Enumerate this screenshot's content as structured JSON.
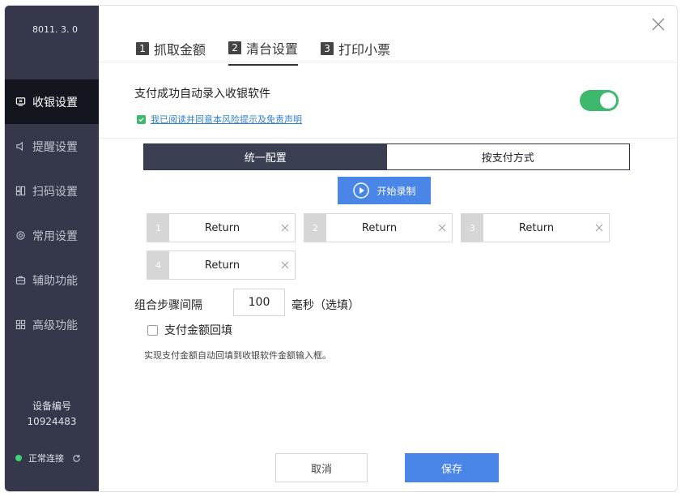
{
  "sidebar": {
    "version": "8011. 3. 0",
    "items": [
      {
        "label": "收银设置",
        "icon": "cash-register-icon",
        "active": true
      },
      {
        "label": "提醒设置",
        "icon": "speaker-icon",
        "active": false
      },
      {
        "label": "扫码设置",
        "icon": "scan-icon",
        "active": false
      },
      {
        "label": "常用设置",
        "icon": "gear-icon",
        "active": false
      },
      {
        "label": "辅助功能",
        "icon": "toolbox-icon",
        "active": false
      },
      {
        "label": "高级功能",
        "icon": "grid-icon",
        "active": false
      }
    ],
    "device_label": "设备编号",
    "device_id": "10924483",
    "status_text": "正常连接",
    "status_color": "#3ed27a"
  },
  "tabs": [
    {
      "num": "1",
      "label": "抓取金额"
    },
    {
      "num": "2",
      "label": "清台设置",
      "active": true
    },
    {
      "num": "3",
      "label": "打印小票"
    }
  ],
  "settings": {
    "auto_entry_label": "支付成功自动录入收银软件",
    "agree_text": "我已阅读并同意本风险提示及免责声明",
    "toggle_on": true,
    "segments": [
      "统一配置",
      "按支付方式"
    ],
    "record_label": "开始录制",
    "keys": [
      {
        "num": "1",
        "label": "Return"
      },
      {
        "num": "2",
        "label": "Return"
      },
      {
        "num": "3",
        "label": "Return"
      },
      {
        "num": "4",
        "label": "Return"
      }
    ],
    "interval_label": "组合步骤间隔",
    "interval_value": "100",
    "interval_unit": "毫秒（选填）",
    "fill_label": "支付金额回填",
    "fill_desc": "实现支付金额自动回填到收银软件金额输入框。"
  },
  "footer": {
    "cancel_label": "取消",
    "save_label": "保存"
  },
  "colors": {
    "accent": "#4a86e8",
    "toggle": "#3db86c",
    "sidebar_bg": "#34384a"
  }
}
